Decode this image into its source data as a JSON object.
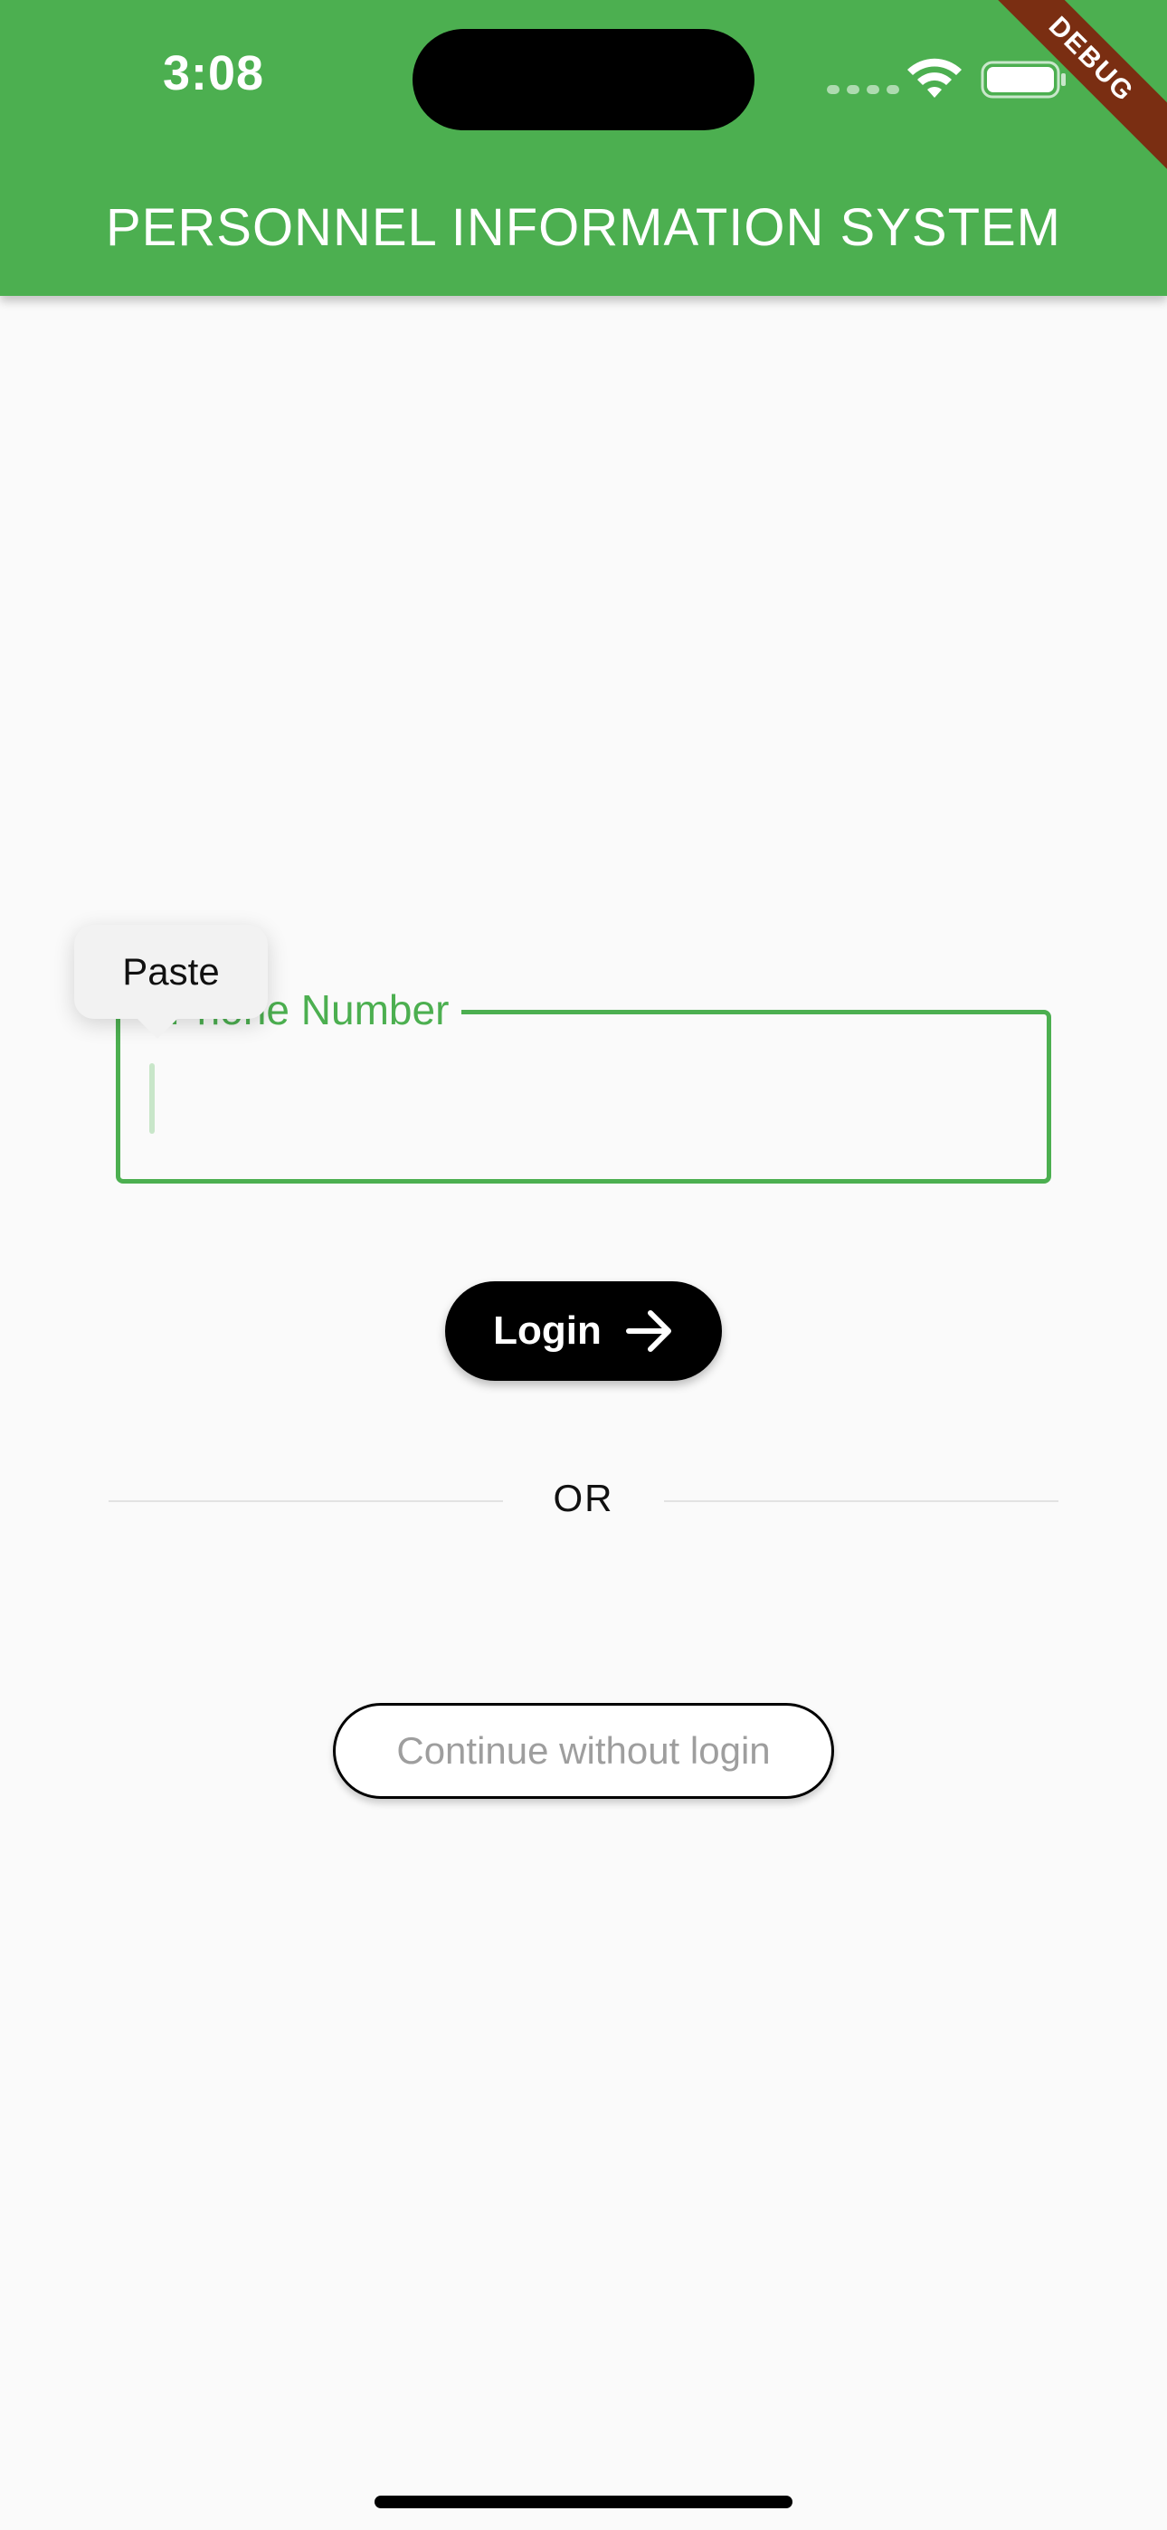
{
  "status_bar": {
    "time": "3:08"
  },
  "app_bar": {
    "title": "PERSONNEL INFORMATION SYSTEM",
    "color": "#4caf50"
  },
  "debug_banner": "DEBUG",
  "login_form": {
    "phone_field": {
      "label": "Phone Number",
      "value": ""
    },
    "login_button": {
      "label": "Login",
      "icon": "arrow-right-icon"
    },
    "divider_text": "OR",
    "continue_button": {
      "label": "Continue without login"
    }
  },
  "context_menu": {
    "paste_label": "Paste"
  },
  "colors": {
    "accent": "#4caf50",
    "button_dark": "#000000",
    "muted_text": "#9e9e9e",
    "debug": "#7a2e12"
  }
}
